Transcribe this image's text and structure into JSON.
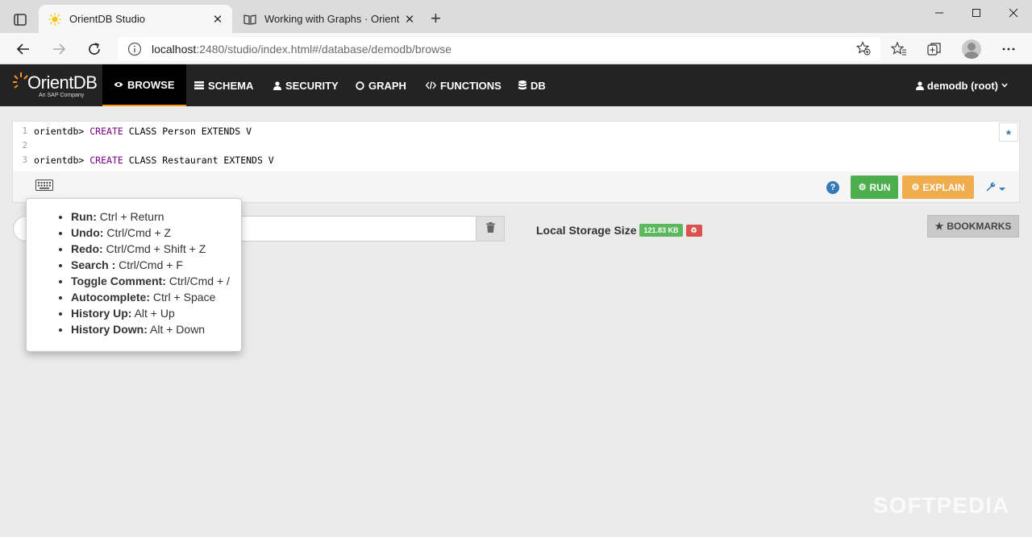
{
  "browser": {
    "tabs": [
      {
        "title": "OrientDB Studio",
        "active": true
      },
      {
        "title": "Working with Graphs · OrientDB",
        "active": false
      }
    ],
    "url": {
      "host": "localhost",
      "path": ":2480/studio/index.html#/database/demodb/browse"
    }
  },
  "navbar": {
    "logo_name": "OrientDB",
    "logo_sub": "An SAP Company",
    "items": [
      {
        "label": "BROWSE",
        "icon": "eye-icon",
        "active": true
      },
      {
        "label": "SCHEMA",
        "icon": "table-icon"
      },
      {
        "label": "SECURITY",
        "icon": "user-icon"
      },
      {
        "label": "GRAPH",
        "icon": "circle-icon"
      },
      {
        "label": "FUNCTIONS",
        "icon": "code-icon"
      },
      {
        "label": "DB",
        "icon": "database-icon"
      }
    ],
    "user": "demodb (root)"
  },
  "editor": {
    "lines": [
      {
        "num": "1",
        "prompt": "orientdb> ",
        "kw": "CREATE",
        "rest": " CLASS Person EXTENDS V"
      },
      {
        "num": "2",
        "prompt": "",
        "kw": "",
        "rest": ""
      },
      {
        "num": "3",
        "prompt": "orientdb> ",
        "kw": "CREATE",
        "rest": " CLASS Restaurant EXTENDS V"
      }
    ],
    "run_label": "RUN",
    "explain_label": "EXPLAIN",
    "help_label": "?"
  },
  "storage": {
    "label": "Local Storage Size",
    "value": "121.83 KB"
  },
  "bookmarks_label": "BOOKMARKS",
  "shortcuts": [
    {
      "name": "Run:",
      "keys": " Ctrl + Return"
    },
    {
      "name": "Undo:",
      "keys": " Ctrl/Cmd + Z"
    },
    {
      "name": "Redo:",
      "keys": " Ctrl/Cmd + Shift + Z"
    },
    {
      "name": "Search :",
      "keys": " Ctrl/Cmd + F"
    },
    {
      "name": "Toggle Comment:",
      "keys": " Ctrl/Cmd + /"
    },
    {
      "name": "Autocomplete:",
      "keys": " Ctrl + Space"
    },
    {
      "name": "History Up:",
      "keys": " Alt + Up"
    },
    {
      "name": "History Down:",
      "keys": " Alt + Down"
    }
  ],
  "watermark": "SOFTPEDIA",
  "colors": {
    "run": "#4cae4c",
    "explain": "#f0ad4e",
    "accent": "#f7931e",
    "nav_bg": "#232323"
  }
}
